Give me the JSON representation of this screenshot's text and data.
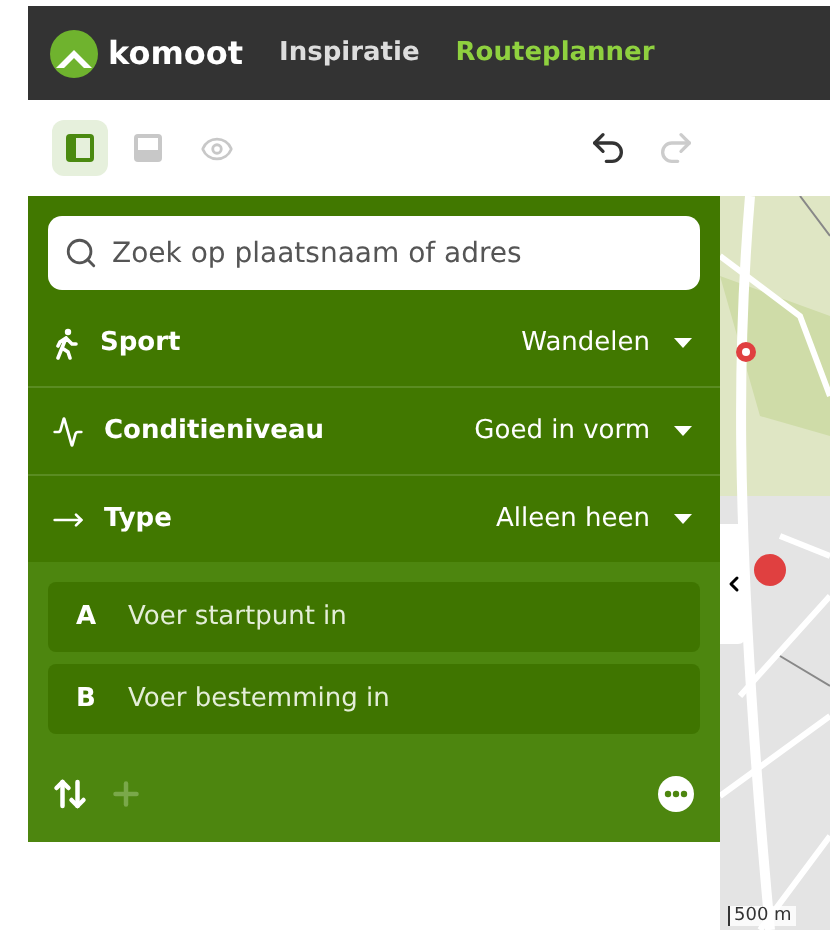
{
  "header": {
    "logo": "komoot",
    "nav": [
      {
        "label": "Inspiratie",
        "selected": false
      },
      {
        "label": "Routeplanner",
        "selected": true
      }
    ]
  },
  "toolbar": {
    "views": [
      {
        "kind": "panel",
        "selected": true
      },
      {
        "kind": "bottom",
        "selected": false
      },
      {
        "kind": "eye",
        "selected": false
      }
    ],
    "undo_disabled": false,
    "redo_disabled": true
  },
  "search": {
    "placeholder": "Zoek op plaatsnaam of adres"
  },
  "settings": [
    {
      "kind": "sport",
      "label": "Sport",
      "value": "Wandelen"
    },
    {
      "kind": "fitness",
      "label": "Conditieniveau",
      "value": "Goed in vorm"
    },
    {
      "kind": "type",
      "label": "Type",
      "value": "Alleen heen"
    }
  ],
  "waypoints": [
    {
      "letter": "A",
      "placeholder": "Voer startpunt in"
    },
    {
      "letter": "B",
      "placeholder": "Voer bestemming in"
    }
  ],
  "add_disabled": true,
  "map": {
    "scale": "500 m"
  }
}
